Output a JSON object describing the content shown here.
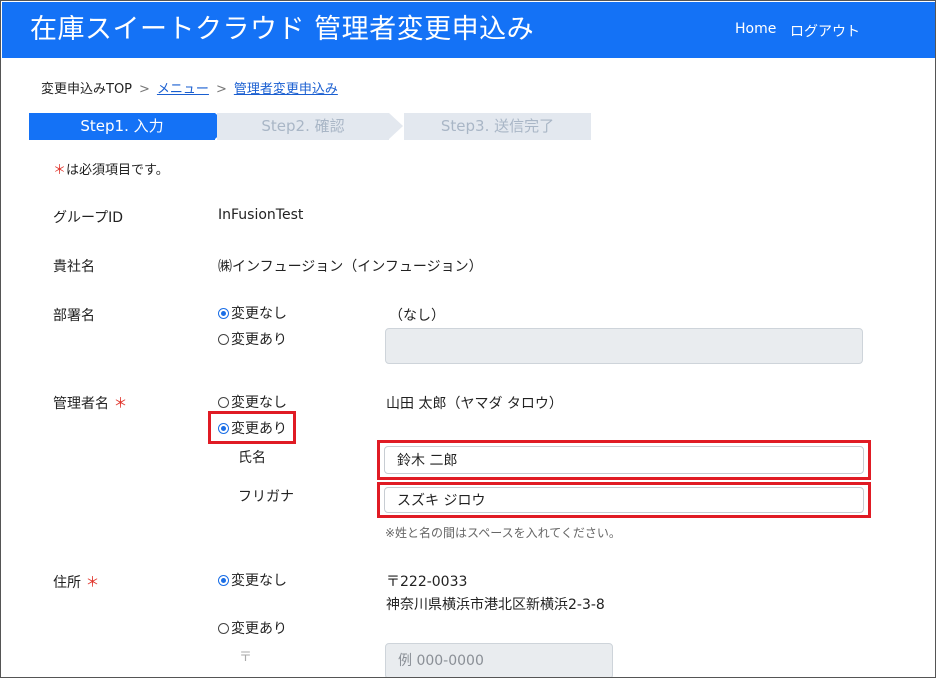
{
  "header": {
    "title": "在庫スイートクラウド 管理者変更申込み",
    "nav_home": "Home",
    "nav_logout": "ログアウト"
  },
  "breadcrumb": {
    "top": "変更申込みTOP",
    "sep": ">",
    "menu": "メニュー",
    "current": "管理者変更申込み"
  },
  "steps": {
    "step1": "Step1. 入力",
    "step2": "Step2. 確認",
    "step3": "Step3. 送信完了"
  },
  "required_note": {
    "star": "＊",
    "text": "は必須項目です。"
  },
  "fields": {
    "group_id": {
      "label": "グループID",
      "value": "InFusionTest"
    },
    "company": {
      "label": "貴社名",
      "value": "㈱インフュージョン（インフュージョン）"
    },
    "department": {
      "label": "部署名",
      "option_no_change": "変更なし",
      "option_change": "変更あり",
      "current_value": "（なし）",
      "input_value": "",
      "selected": "no_change"
    },
    "admin_name": {
      "label": "管理者名",
      "star": "＊",
      "option_no_change": "変更なし",
      "option_change": "変更あり",
      "current_value": "山田 太郎（ヤマダ タロウ）",
      "selected": "change",
      "name_label": "氏名",
      "name_value": "鈴木 二郎",
      "kana_label": "フリガナ",
      "kana_value": "スズキ ジロウ",
      "hint": "※姓と名の間はスペースを入れてください。"
    },
    "address": {
      "label": "住所",
      "star": "＊",
      "option_no_change": "変更なし",
      "option_change": "変更あり",
      "selected": "no_change",
      "current_zip": "〒222-0033",
      "current_address": "神奈川県横浜市港北区新横浜2-3-8",
      "zip_mark": "〒",
      "zip_placeholder": "例 000-0000"
    }
  },
  "colors": {
    "primary": "#1472f6",
    "required": "#e0342b",
    "highlight": "#e01b24",
    "link": "#1a5fd1"
  }
}
